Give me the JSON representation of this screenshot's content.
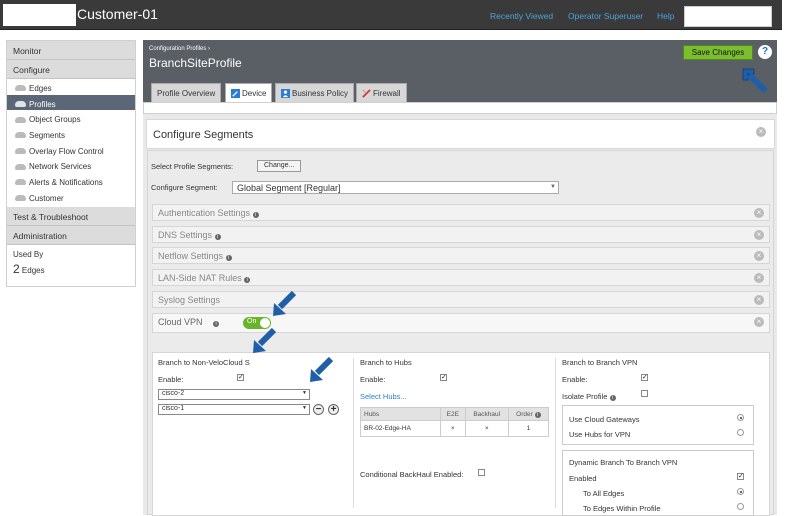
{
  "app": {
    "customer": "Customer-01"
  },
  "topnav": {
    "recently_viewed": "Recently Viewed",
    "operator": "Operator Superuser",
    "help": "Help"
  },
  "sidebar": {
    "monitor": "Monitor",
    "configure": "Configure",
    "items": [
      {
        "label": "Edges",
        "icon": "cloud-icon"
      },
      {
        "label": "Profiles",
        "icon": "cloud-icon",
        "active": true
      },
      {
        "label": "Object Groups",
        "icon": "cloud-icon"
      },
      {
        "label": "Segments",
        "icon": "cloud-icon"
      },
      {
        "label": "Overlay Flow Control",
        "icon": "cloud-icon"
      },
      {
        "label": "Network Services",
        "icon": "cloud-icon"
      },
      {
        "label": "Alerts & Notifications",
        "icon": "cloud-icon"
      },
      {
        "label": "Customer",
        "icon": "cloud-icon"
      }
    ],
    "test": "Test & Troubleshoot",
    "admin": "Administration",
    "used_by": "Used By",
    "count": "2",
    "count_unit": "Edges"
  },
  "header": {
    "breadcrumb": "Configuration Profiles ›",
    "title": "BranchSiteProfile",
    "save": "Save Changes",
    "help": "?"
  },
  "tabs": [
    {
      "label": "Profile Overview"
    },
    {
      "label": "Device",
      "active": true
    },
    {
      "label": "Business Policy"
    },
    {
      "label": "Firewall"
    }
  ],
  "segments": {
    "title": "Configure Segments",
    "select_label": "Select Profile Segments:",
    "change": "Change...",
    "configure_label": "Configure Segment:",
    "configure_value": "Global Segment [Regular]"
  },
  "accordions": [
    {
      "label": "Authentication Settings",
      "info": true
    },
    {
      "label": "DNS Settings",
      "info": true
    },
    {
      "label": "Netflow Settings",
      "info": true
    },
    {
      "label": "LAN-Side NAT Rules",
      "info": true
    },
    {
      "label": "Syslog Settings",
      "info": false
    }
  ],
  "vpn": {
    "title": "Cloud VPN",
    "toggle": "On",
    "non_velo": {
      "title": "Branch to Non-VeloCloud S",
      "enable": "Enable:",
      "enabled": true,
      "sites": [
        "cisco-2",
        "cisco-1"
      ]
    },
    "hubs": {
      "title": "Branch to Hubs",
      "enable": "Enable:",
      "enabled": true,
      "select": "Select Hubs...",
      "columns": [
        "Hubs",
        "E2E",
        "Backhaul",
        "Order"
      ],
      "rows": [
        {
          "hub": "BR-02-Edge-HA",
          "e2e": "×",
          "backhaul": "×",
          "order": "1"
        }
      ],
      "conditional": "Conditional BackHaul Enabled:"
    },
    "b2b": {
      "title": "Branch to Branch VPN",
      "enable": "Enable:",
      "enabled": true,
      "isolate": "Isolate Profile",
      "cloud_gateways": "Use Cloud Gateways",
      "hubs_for_vpn": "Use Hubs for VPN",
      "dynamic_title": "Dynamic Branch To Branch VPN",
      "dynamic_enabled": "Enabled",
      "all_edges": "To All Edges",
      "within_profile": "To Edges Within Profile"
    }
  },
  "colors": {
    "accent": "#4aa3df",
    "save": "#7bbf2f",
    "header": "#5a5f66",
    "arrow": "#1f5fa8"
  }
}
